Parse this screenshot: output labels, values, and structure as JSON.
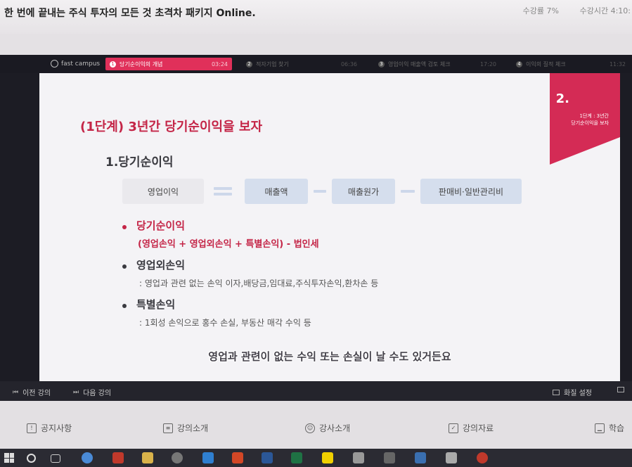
{
  "course": {
    "title": "한 번에 끝내는 주식 투자의 모든 것 초격차 패키지 Online.",
    "progress_label": "수강률",
    "progress_value": "7%",
    "study_time_label": "수강시간",
    "study_time_value": "4:10:"
  },
  "player": {
    "logo": "fast campus",
    "chapters": [
      {
        "num": "1",
        "label": "당기순이익의 개념",
        "time": "03:24",
        "active": true
      },
      {
        "num": "2",
        "label": "적자기업 찾기",
        "time": "06:36",
        "active": false
      },
      {
        "num": "3",
        "label": "영업이익 매출액 검토 체크",
        "time": "17:20",
        "active": false
      },
      {
        "num": "4",
        "label": "이익의 질적 체크",
        "time": "11:32",
        "active": false
      }
    ]
  },
  "slide": {
    "corner_number": "2.",
    "corner_caption_line1": "1단계 : 3년간",
    "corner_caption_line2": "당기순이익을 보자",
    "title": "(1단계) 3년간 당기순이익을 보자",
    "section": "1.당기순이익",
    "formula": {
      "term1": "영업이익",
      "term2": "매출액",
      "term3": "매출원가",
      "term4": "판매비·일반관리비"
    },
    "bullets": [
      {
        "heading": "당기순이익",
        "detail": "(영업손익 + 영업외손익 + 특별손익) - 법인세"
      },
      {
        "heading": "영업외손익",
        "detail": ": 영업과 관련 없는 손익 이자,배당금,임대료,주식투자손익,환차손 등"
      },
      {
        "heading": "특별손익",
        "detail": ": 1회성 손익으로 홍수 손실, 부동산 매각 수익 등"
      }
    ],
    "subtitle": "영업과 관련이 없는 수익 또는 손실이 날 수도 있거든요"
  },
  "controls": {
    "prev_label": "이전 강의",
    "next_label": "다음 강의",
    "quality_label": "화질 설정"
  },
  "tabs": [
    {
      "label": "공지사항",
      "icon": "notice-icon"
    },
    {
      "label": "강의소개",
      "icon": "document-icon"
    },
    {
      "label": "강사소개",
      "icon": "person-icon"
    },
    {
      "label": "강의자료",
      "icon": "clipboard-icon"
    },
    {
      "label": "학습",
      "icon": "chart-icon"
    }
  ],
  "colors": {
    "accent": "#d42b55",
    "formula_box": "#d5deed"
  }
}
